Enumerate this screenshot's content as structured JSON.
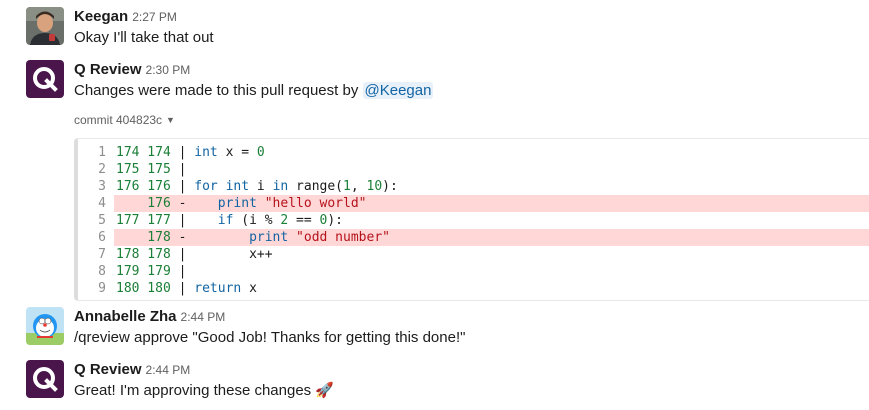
{
  "messages": [
    {
      "sender": "Keegan",
      "time": "2:27 PM",
      "text": "Okay I'll take that out",
      "avatar_icon": "person-photo-avatar"
    },
    {
      "sender": "Q Review",
      "time": "2:30 PM",
      "text_before_mention": "Changes were made to this pull request by ",
      "mention": "@Keegan",
      "commit_label": "commit 404823c",
      "avatar_icon": "q-logo-avatar",
      "avatar_color": "#4a154b",
      "code_lines": [
        {
          "n": "1",
          "old": "174",
          "new": "174",
          "mark": "|",
          "code": "int x = 0",
          "removed": false
        },
        {
          "n": "2",
          "old": "175",
          "new": "175",
          "mark": "|",
          "code": "",
          "removed": false
        },
        {
          "n": "3",
          "old": "176",
          "new": "176",
          "mark": "|",
          "code": "for int i in range(1, 10):",
          "removed": false
        },
        {
          "n": "4",
          "old": "",
          "new": "176",
          "mark": "-",
          "code": "   print \"hello world\"",
          "removed": true
        },
        {
          "n": "5",
          "old": "177",
          "new": "177",
          "mark": "|",
          "code": "   if (i % 2 == 0):",
          "removed": false
        },
        {
          "n": "6",
          "old": "",
          "new": "178",
          "mark": "-",
          "code": "       print \"odd number\"",
          "removed": true
        },
        {
          "n": "7",
          "old": "178",
          "new": "178",
          "mark": "|",
          "code": "       x++",
          "removed": false
        },
        {
          "n": "8",
          "old": "179",
          "new": "179",
          "mark": "|",
          "code": "",
          "removed": false
        },
        {
          "n": "9",
          "old": "180",
          "new": "180",
          "mark": "|",
          "code": "return x",
          "removed": false
        }
      ]
    },
    {
      "sender": "Annabelle Zha",
      "time": "2:44 PM",
      "text": "/qreview approve \"Good Job! Thanks for getting this done!\"",
      "avatar_icon": "cartoon-robot-cat-avatar"
    },
    {
      "sender": "Q Review",
      "time": "2:44 PM",
      "text": "Great! I'm approving these changes",
      "emoji": "🚀",
      "avatar_icon": "q-logo-avatar",
      "avatar_color": "#4a154b"
    }
  ],
  "colors": {
    "removed_line_bg": "#ffd7d7",
    "mention_bg": "#e8f1f9",
    "mention_text": "#1264a3",
    "line_number_green": "#1a7f37"
  }
}
